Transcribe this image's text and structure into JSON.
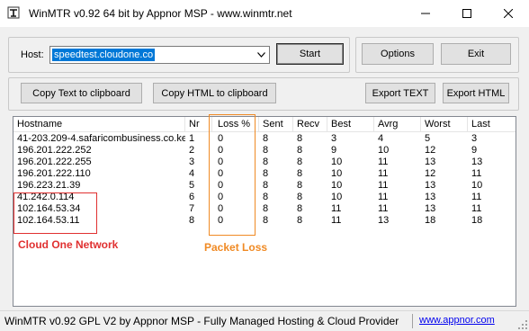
{
  "window": {
    "title": "WinMTR v0.92 64 bit by Appnor MSP - www.winmtr.net",
    "icon": "winmtr-app-icon",
    "controls": [
      "minimize-icon",
      "maximize-icon",
      "close-icon"
    ]
  },
  "host": {
    "label": "Host:",
    "value": "speedtest.cloudone.co"
  },
  "buttons": {
    "start": "Start",
    "options": "Options",
    "exit": "Exit",
    "copy_text": "Copy Text to clipboard",
    "copy_html": "Copy HTML to clipboard",
    "export_text": "Export TEXT",
    "export_html": "Export HTML"
  },
  "table": {
    "columns": [
      "Hostname",
      "Nr",
      "Loss %",
      "Sent",
      "Recv",
      "Best",
      "Avrg",
      "Worst",
      "Last"
    ],
    "rows": [
      [
        "41-203.209-4.safaricombusiness.co.ke",
        "1",
        "0",
        "8",
        "8",
        "3",
        "4",
        "5",
        "3"
      ],
      [
        "196.201.222.252",
        "2",
        "0",
        "8",
        "8",
        "9",
        "10",
        "12",
        "9"
      ],
      [
        "196.201.222.255",
        "3",
        "0",
        "8",
        "8",
        "10",
        "11",
        "13",
        "13"
      ],
      [
        "196.201.222.110",
        "4",
        "0",
        "8",
        "8",
        "10",
        "11",
        "12",
        "11"
      ],
      [
        "196.223.21.39",
        "5",
        "0",
        "8",
        "8",
        "10",
        "11",
        "13",
        "10"
      ],
      [
        "41.242.0.114",
        "6",
        "0",
        "8",
        "8",
        "10",
        "11",
        "13",
        "11"
      ],
      [
        "102.164.53.34",
        "7",
        "0",
        "8",
        "8",
        "11",
        "11",
        "13",
        "11"
      ],
      [
        "102.164.53.11",
        "8",
        "0",
        "8",
        "8",
        "11",
        "13",
        "18",
        "18"
      ]
    ]
  },
  "annotations": {
    "cloud_one_label": "Cloud One Network",
    "packet_loss_label": "Packet Loss",
    "red_color": "#e03030",
    "orange_color": "#f08a24"
  },
  "statusbar": {
    "text": "WinMTR v0.92 GPL V2 by Appnor MSP - Fully Managed Hosting & Cloud Provider",
    "link": "www.appnor.com"
  }
}
